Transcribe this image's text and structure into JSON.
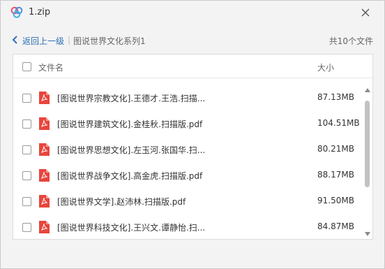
{
  "window": {
    "title": "1.zip",
    "close_icon": "close-icon",
    "logo_icon": "cloud-logo-icon"
  },
  "nav": {
    "back_label": "返回上一级",
    "separator": "|",
    "breadcrumb": "图说世界文化系列1",
    "file_count": "共10个文件"
  },
  "list": {
    "header_name": "文件名",
    "header_size": "大小",
    "files": [
      {
        "name": "[图说世界宗教文化].王德才.王浩.扫描...",
        "size": "87.13MB",
        "icon": "pdf-icon"
      },
      {
        "name": "[图说世界建筑文化].金桂秋.扫描版.pdf",
        "size": "104.51MB",
        "icon": "pdf-icon"
      },
      {
        "name": "[图说世界思想文化].左玉河.张国华.扫...",
        "size": "80.21MB",
        "icon": "pdf-icon"
      },
      {
        "name": "[图说世界战争文化].高金虎.扫描版.pdf",
        "size": "88.17MB",
        "icon": "pdf-icon"
      },
      {
        "name": "[图说世界文学].赵沛林.扫描版.pdf",
        "size": "91.50MB",
        "icon": "pdf-icon"
      },
      {
        "name": "[图说世界科技文化].王兴文.谭静怡.扫...",
        "size": "84.87MB",
        "icon": "pdf-icon"
      }
    ]
  },
  "colors": {
    "link": "#2f6fb5",
    "pdf_red": "#e8453c",
    "logo_red": "#e9546b",
    "logo_blue": "#4a90e2"
  }
}
